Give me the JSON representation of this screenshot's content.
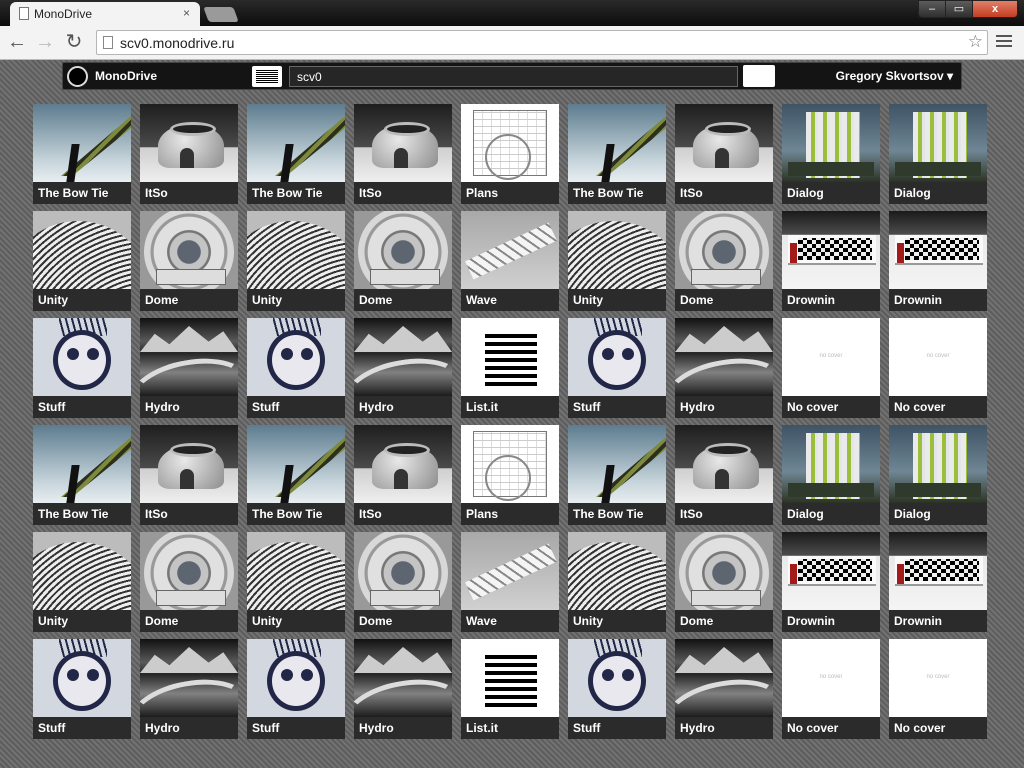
{
  "browser": {
    "tab_title": "MonoDrive",
    "tab_close": "×",
    "window_minimize": "–",
    "window_maximize": "▭",
    "window_close": "x",
    "back": "←",
    "forward": "→",
    "reload": "↻",
    "url": "scv0.monodrive.ru",
    "bookmark_star": "☆"
  },
  "app": {
    "brand": "MonoDrive",
    "search_value": "scv0",
    "user_name": "Gregory Skvortsov ▾"
  },
  "grid": {
    "no_cover_text": "no cover",
    "rows": [
      [
        {
          "t": "bowtie",
          "label": "The Bow Tie"
        },
        {
          "t": "itso",
          "label": "ItSo"
        },
        {
          "t": "bowtie",
          "label": "The Bow Tie"
        },
        {
          "t": "itso",
          "label": "ItSo"
        },
        {
          "t": "plans",
          "label": "Plans"
        },
        {
          "t": "bowtie",
          "label": "The Bow Tie"
        },
        {
          "t": "itso",
          "label": "ItSo"
        },
        {
          "t": "dialog",
          "label": "Dialog"
        },
        {
          "t": "dialog",
          "label": "Dialog"
        }
      ],
      [
        {
          "t": "unity",
          "label": "Unity"
        },
        {
          "t": "dome",
          "label": "Dome"
        },
        {
          "t": "unity",
          "label": "Unity"
        },
        {
          "t": "dome",
          "label": "Dome"
        },
        {
          "t": "wave",
          "label": "Wave"
        },
        {
          "t": "unity",
          "label": "Unity"
        },
        {
          "t": "dome",
          "label": "Dome"
        },
        {
          "t": "drownin",
          "label": "Drownin"
        },
        {
          "t": "drownin",
          "label": "Drownin"
        }
      ],
      [
        {
          "t": "stuff",
          "label": "Stuff"
        },
        {
          "t": "hydro",
          "label": "Hydro"
        },
        {
          "t": "stuff",
          "label": "Stuff"
        },
        {
          "t": "hydro",
          "label": "Hydro"
        },
        {
          "t": "list",
          "label": "List.it"
        },
        {
          "t": "stuff",
          "label": "Stuff"
        },
        {
          "t": "hydro",
          "label": "Hydro"
        },
        {
          "t": "nocover",
          "label": "No cover"
        },
        {
          "t": "nocover",
          "label": "No cover"
        }
      ],
      [
        {
          "t": "bowtie",
          "label": "The Bow Tie"
        },
        {
          "t": "itso",
          "label": "ItSo"
        },
        {
          "t": "bowtie",
          "label": "The Bow Tie"
        },
        {
          "t": "itso",
          "label": "ItSo"
        },
        {
          "t": "plans",
          "label": "Plans"
        },
        {
          "t": "bowtie",
          "label": "The Bow Tie"
        },
        {
          "t": "itso",
          "label": "ItSo"
        },
        {
          "t": "dialog",
          "label": "Dialog"
        },
        {
          "t": "dialog",
          "label": "Dialog"
        }
      ],
      [
        {
          "t": "unity",
          "label": "Unity"
        },
        {
          "t": "dome",
          "label": "Dome"
        },
        {
          "t": "unity",
          "label": "Unity"
        },
        {
          "t": "dome",
          "label": "Dome"
        },
        {
          "t": "wave",
          "label": "Wave"
        },
        {
          "t": "unity",
          "label": "Unity"
        },
        {
          "t": "dome",
          "label": "Dome"
        },
        {
          "t": "drownin",
          "label": "Drownin"
        },
        {
          "t": "drownin",
          "label": "Drownin"
        }
      ],
      [
        {
          "t": "stuff",
          "label": "Stuff"
        },
        {
          "t": "hydro",
          "label": "Hydro"
        },
        {
          "t": "stuff",
          "label": "Stuff"
        },
        {
          "t": "hydro",
          "label": "Hydro"
        },
        {
          "t": "list",
          "label": "List.it"
        },
        {
          "t": "stuff",
          "label": "Stuff"
        },
        {
          "t": "hydro",
          "label": "Hydro"
        },
        {
          "t": "nocover",
          "label": "No cover"
        },
        {
          "t": "nocover",
          "label": "No cover"
        }
      ]
    ]
  }
}
